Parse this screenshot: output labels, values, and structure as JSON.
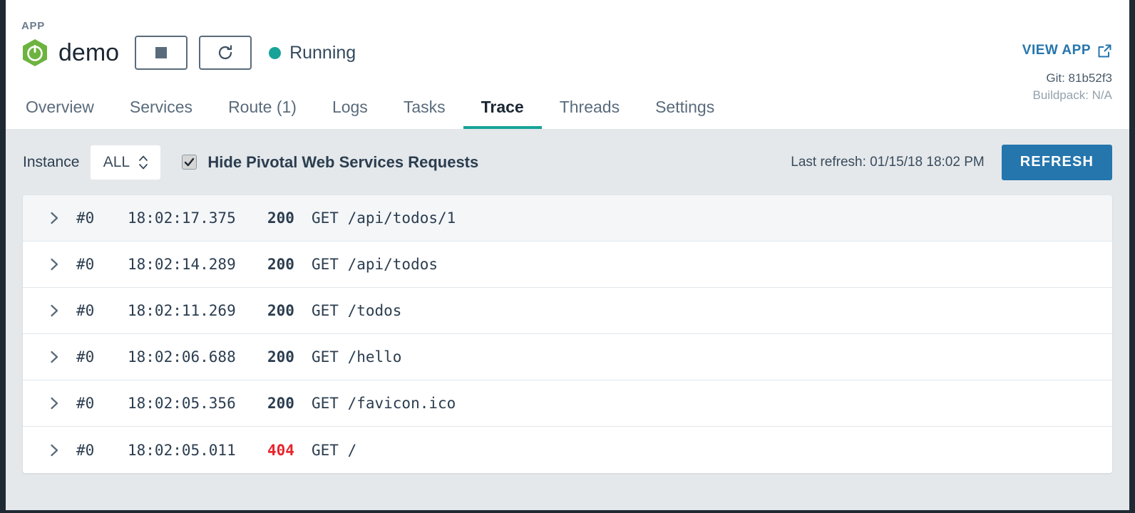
{
  "header": {
    "app_label": "APP",
    "app_name": "demo",
    "logo_icon": "spring-boot-logo",
    "stop_icon": "stop-square-icon",
    "restart_icon": "restart-circular-arrow-icon",
    "status_text": "Running",
    "status_color": "#17a398",
    "view_app_label": "VIEW APP",
    "view_app_icon": "external-link-icon",
    "git_text": "Git: 81b52f3",
    "buildpack_text": "Buildpack: N/A",
    "link_color": "#2576ad"
  },
  "tabs": [
    {
      "label": "Overview",
      "active": false
    },
    {
      "label": "Services",
      "active": false
    },
    {
      "label": "Route (1)",
      "active": false
    },
    {
      "label": "Logs",
      "active": false
    },
    {
      "label": "Tasks",
      "active": false
    },
    {
      "label": "Trace",
      "active": true
    },
    {
      "label": "Threads",
      "active": false
    },
    {
      "label": "Settings",
      "active": false
    }
  ],
  "filterbar": {
    "instance_label": "Instance",
    "instance_value": "ALL",
    "instance_options": [
      "ALL"
    ],
    "spinner_icon": "chevron-up-down-icon",
    "hide_requests_label": "Hide Pivotal Web Services Requests",
    "hide_requests_checked": true,
    "last_refresh_text": "Last refresh: 01/15/18 18:02 PM",
    "refresh_button_label": "REFRESH",
    "refresh_button_color": "#2576ad"
  },
  "trace_rows": [
    {
      "expand_icon": "chevron-right-icon",
      "instance": "#0",
      "time": "18:02:17.375",
      "status": "200",
      "error": false,
      "request": "GET /api/todos/1"
    },
    {
      "expand_icon": "chevron-right-icon",
      "instance": "#0",
      "time": "18:02:14.289",
      "status": "200",
      "error": false,
      "request": "GET /api/todos"
    },
    {
      "expand_icon": "chevron-right-icon",
      "instance": "#0",
      "time": "18:02:11.269",
      "status": "200",
      "error": false,
      "request": "GET /todos"
    },
    {
      "expand_icon": "chevron-right-icon",
      "instance": "#0",
      "time": "18:02:06.688",
      "status": "200",
      "error": false,
      "request": "GET /hello"
    },
    {
      "expand_icon": "chevron-right-icon",
      "instance": "#0",
      "time": "18:02:05.356",
      "status": "200",
      "error": false,
      "request": "GET /favicon.ico"
    },
    {
      "expand_icon": "chevron-right-icon",
      "instance": "#0",
      "time": "18:02:05.011",
      "status": "404",
      "error": true,
      "request": "GET /"
    }
  ],
  "colors": {
    "error_status": "#e8242c",
    "accent_teal": "#17a398",
    "page_background": "#e4e8eb"
  }
}
